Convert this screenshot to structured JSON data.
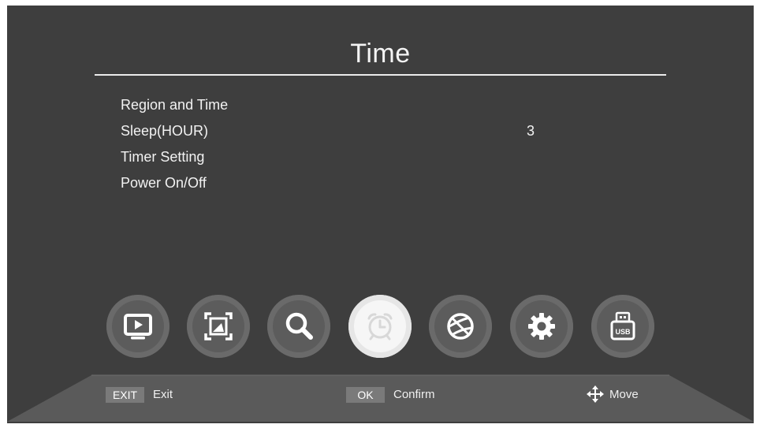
{
  "header": {
    "title": "Time"
  },
  "menu": {
    "items": [
      {
        "label": "Region and Time",
        "value": ""
      },
      {
        "label": "Sleep(HOUR)",
        "value": "3"
      },
      {
        "label": "Timer Setting",
        "value": ""
      },
      {
        "label": "Power On/Off",
        "value": ""
      }
    ]
  },
  "nav_icons": [
    {
      "name": "tv-icon",
      "active": false
    },
    {
      "name": "picture-icon",
      "active": false
    },
    {
      "name": "search-icon",
      "active": false
    },
    {
      "name": "alarm-clock-icon",
      "active": true
    },
    {
      "name": "globe-icon",
      "active": false
    },
    {
      "name": "gear-icon",
      "active": false
    },
    {
      "name": "usb-icon",
      "active": false
    }
  ],
  "footer": {
    "exit_key": "EXIT",
    "exit_label": "Exit",
    "ok_key": "OK",
    "ok_label": "Confirm",
    "move_label": "Move"
  },
  "colors": {
    "background": "#3e3e3e",
    "icon_inactive": "#5c5c5c",
    "icon_active": "#f6f6f6",
    "key_badge": "#7a7a7a"
  }
}
